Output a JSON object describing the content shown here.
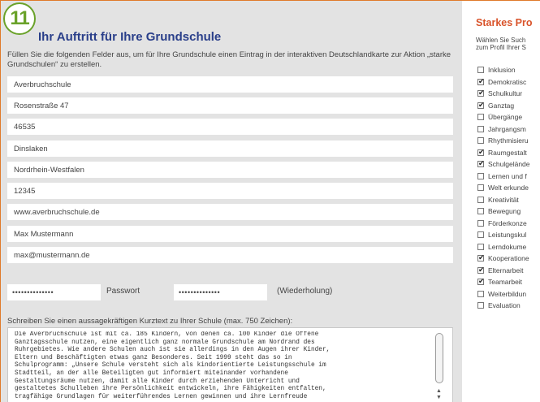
{
  "badge": "11",
  "form": {
    "title": "Ihr Auftritt für Ihre Grundschule",
    "intro": "Füllen Sie die folgenden Felder aus, um für Ihre Grundschule einen Eintrag in der interaktiven Deutschlandkarte zur Aktion „starke Grundschulen“ zu erstellen.",
    "fields": [
      "Averbruchschule",
      "Rosenstraße 47",
      "46535",
      "Dinslaken",
      "Nordrhein-Westfalen",
      "12345",
      "www.averbruchschule.de",
      "Max Mustermann",
      "max@mustermann.de"
    ],
    "password_value": "••••••••••••••",
    "password_label": "Passwort",
    "password_repeat_value": "••••••••••••••",
    "password_repeat_label": "(Wiederholung)",
    "kurztext_label": "Schreiben Sie einen aussagekräftigen Kurztext zu Ihrer Schule (max. 750 Zeichen):",
    "kurztext_value": "Die Averbruchschule ist mit ca. 185 Kindern, von denen ca. 100 Kinder die Offene\nGanztagsschule nutzen, eine eigentlich ganz normale Grundschule am Nordrand des\nRuhrgebietes. Wie andere Schulen auch ist sie allerdings in den Augen ihrer Kinder,\nEltern und Beschäftigten etwas ganz Besonderes. Seit 1999 steht das so in\nSchulprogramm: „Unsere Schule versteht sich als kindorientierte Leistungsschule im\nStadtteil, an der alle Beteiligten gut informiert miteinander vorhandene\nGestaltungsräume nutzen, damit alle Kinder durch erziehenden Unterricht und\ngestaltetes Schulleben ihre Persönlichkeit entwickeln, ihre Fähigkeiten entfalten,\ntragfähige Grundlagen für weiterführendes Lernen gewinnen und ihre Lernfreude"
  },
  "profile": {
    "title": "Starkes Pro",
    "intro_line1": "Wählen Sie Such",
    "intro_line2": "zum Profil Ihrer S",
    "items": [
      {
        "label": "Inklusion",
        "checked": false
      },
      {
        "label": "Demokratisc",
        "checked": true
      },
      {
        "label": "Schulkultur",
        "checked": true
      },
      {
        "label": "Ganztag",
        "checked": true
      },
      {
        "label": "Übergänge",
        "checked": false
      },
      {
        "label": "Jahrgangsm",
        "checked": false
      },
      {
        "label": "Rhythmisieru",
        "checked": false
      },
      {
        "label": "Raumgestalt",
        "checked": true
      },
      {
        "label": "Schulgelände",
        "checked": true
      },
      {
        "label": "Lernen und f",
        "checked": false
      },
      {
        "label": "Welt erkunde",
        "checked": false
      },
      {
        "label": "Kreativität",
        "checked": false
      },
      {
        "label": "Bewegung",
        "checked": false
      },
      {
        "label": "Förderkonze",
        "checked": false
      },
      {
        "label": "Leistungskul",
        "checked": false
      },
      {
        "label": "Lerndokume",
        "checked": false
      },
      {
        "label": "Kooperatione",
        "checked": true
      },
      {
        "label": "Elternarbeit",
        "checked": true
      },
      {
        "label": "Teamarbeit",
        "checked": true
      },
      {
        "label": "Weiterbildun",
        "checked": false
      },
      {
        "label": "Evaluation",
        "checked": false
      }
    ]
  },
  "colors": {
    "accent_green": "#6aa22a",
    "title_blue": "#2a3f8a",
    "profile_orange": "#d9532a",
    "panel_bg": "#e3e3e3"
  }
}
